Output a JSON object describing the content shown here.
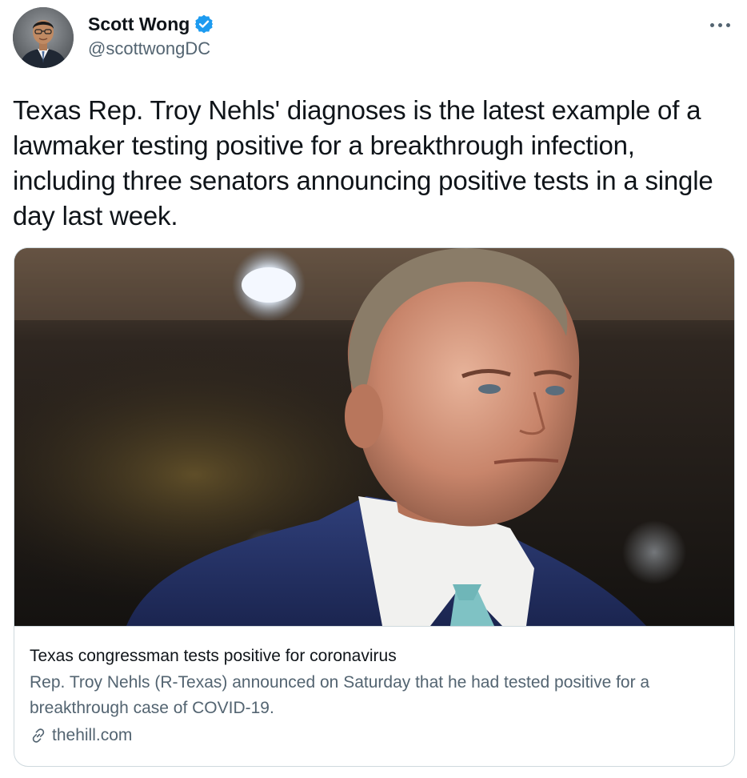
{
  "author": {
    "name": "Scott Wong",
    "handle": "@scottwongDC"
  },
  "tweet": {
    "text": "Texas Rep. Troy Nehls' diagnoses is the latest example of a lawmaker testing positive for a breakthrough infection, including three senators announcing positive tests in a single day last week."
  },
  "card": {
    "title": "Texas congressman tests positive for coronavirus",
    "description": "Rep. Troy Nehls (R-Texas) announced on Saturday that he had tested positive for a breakthrough case of COVID-19.",
    "domain": "thehill.com"
  },
  "icons": {
    "verified": "verified-badge-icon",
    "more": "more-options-icon",
    "link": "link-icon"
  },
  "colors": {
    "primary_text": "#0f1419",
    "secondary_text": "#536471",
    "verified_blue": "#1d9bf0",
    "card_border": "#cfd9de"
  }
}
